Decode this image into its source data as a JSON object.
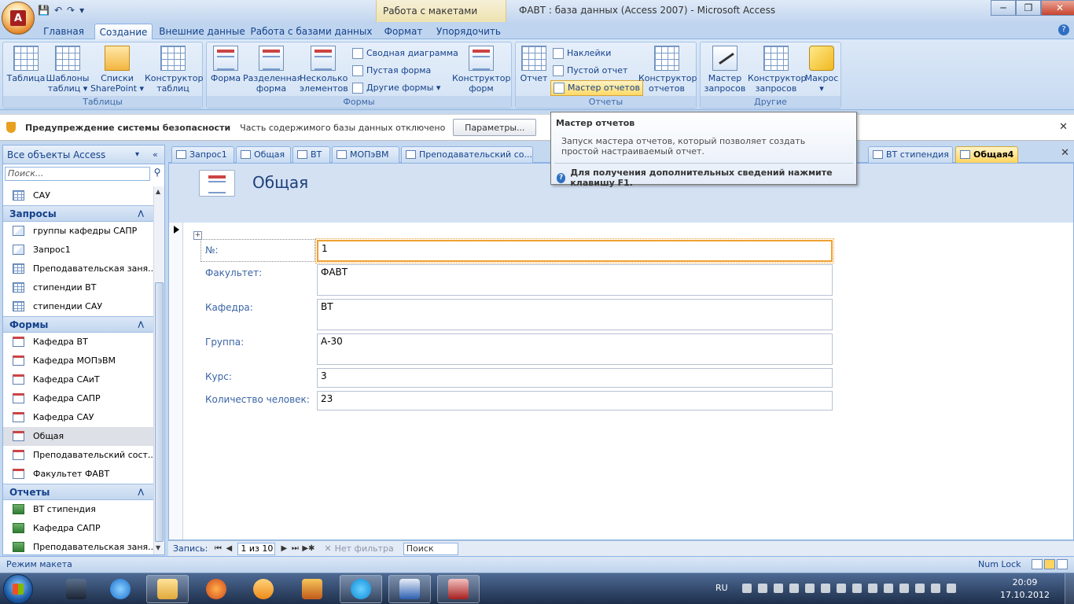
{
  "window": {
    "context_tab_title": "Работа с макетами форм",
    "app_title": "ФАВТ : база данных (Access 2007) - Microsoft Access",
    "qat_icons": [
      "save-icon",
      "undo-icon",
      "redo-icon",
      "customize-icon"
    ],
    "min": "─",
    "max": "❐",
    "close": "✕",
    "help": "?"
  },
  "ribbon_tabs": [
    "Главная",
    "Создание",
    "Внешние данные",
    "Работа с базами данных",
    "Формат",
    "Упорядочить"
  ],
  "ribbon": {
    "groups": {
      "tables": "Таблицы",
      "forms": "Формы",
      "reports": "Отчеты",
      "other": "Другие"
    },
    "tables": {
      "table": "Таблица",
      "templates_1": "Шаблоны",
      "templates_2": "таблиц ▾",
      "sharepoint_1": "Списки",
      "sharepoint_2": "SharePoint ▾",
      "designer_1": "Конструктор",
      "designer_2": "таблиц"
    },
    "forms": {
      "form": "Форма",
      "split_1": "Разделенная",
      "split_2": "форма",
      "multi_1": "Несколько",
      "multi_2": "элементов",
      "pivot_chart": "Сводная диаграмма",
      "blank_form": "Пустая форма",
      "more_forms": "Другие формы ▾",
      "designer_1": "Конструктор",
      "designer_2": "форм"
    },
    "reports": {
      "report": "Отчет",
      "labels": "Наклейки",
      "blank_report": "Пустой отчет",
      "wizard": "Мастер отчетов",
      "designer_1": "Конструктор",
      "designer_2": "отчетов"
    },
    "other": {
      "query_wizard_1": "Мастер",
      "query_wizard_2": "запросов",
      "query_designer_1": "Конструктор",
      "query_designer_2": "запросов",
      "macro_1": "Макрос",
      "macro_2": "▾"
    }
  },
  "security": {
    "title": "Предупреждение системы безопасности",
    "message": "Часть содержимого базы данных отключено",
    "button": "Параметры...",
    "close": "✕"
  },
  "tooltip": {
    "title": "Мастер отчетов",
    "description": "Запуск мастера отчетов, который позволяет создать простой настраиваемый отчет.",
    "help": "Для получения дополнительных сведений нажмите клавишу F1."
  },
  "nav": {
    "header": "Все объекты Access",
    "dropdown": "▾",
    "collapse": "«",
    "search_placeholder": "Поиск...",
    "search_icon": "⚲",
    "top_item": "САУ",
    "categories": {
      "queries": "Запросы",
      "forms": "Формы",
      "reports": "Отчеты"
    },
    "collapse_arrow": "⋀",
    "queries": [
      "группы кафедры САПР",
      "Запрос1",
      "Преподавательская заня...",
      "стипендии ВТ",
      "стипендии САУ"
    ],
    "forms": [
      "Кафедра ВТ",
      "Кафедра МОПэВМ",
      "Кафедра САиТ",
      "Кафедра САПР",
      "Кафедра САУ",
      "Общая",
      "Преподавательский сост...",
      "Факультет ФАВТ"
    ],
    "reports": [
      "ВТ стипендия",
      "Кафедра САПР",
      "Преподавательская заня..."
    ]
  },
  "doc_tabs": [
    "Запрос1",
    "Общая",
    "ВТ",
    "МОПэВМ",
    "Преподавательский со...",
    "ВТ стипендия",
    "Общая4"
  ],
  "doc_close": "✕",
  "form": {
    "title": "Общая",
    "fields": [
      {
        "label": "№:",
        "value": "1"
      },
      {
        "label": "Факультет:",
        "value": "ФАВТ"
      },
      {
        "label": "Кафедра:",
        "value": "ВТ"
      },
      {
        "label": "Группа:",
        "value": "А-30"
      },
      {
        "label": "Курс:",
        "value": "3"
      },
      {
        "label": "Количество человек:",
        "value": "23"
      }
    ]
  },
  "record_nav": {
    "label": "Запись:",
    "first": "⏮",
    "prev": "◀",
    "position": "1 из 10",
    "next": "▶",
    "last": "⏭",
    "new": "▶✱",
    "filter": "Нет фильтра",
    "search": "Поиск"
  },
  "status": {
    "left": "Режим макета",
    "right": "Num Lock"
  },
  "taskbar": {
    "lang": "RU",
    "time": "20:09",
    "date": "17.10.2012"
  }
}
